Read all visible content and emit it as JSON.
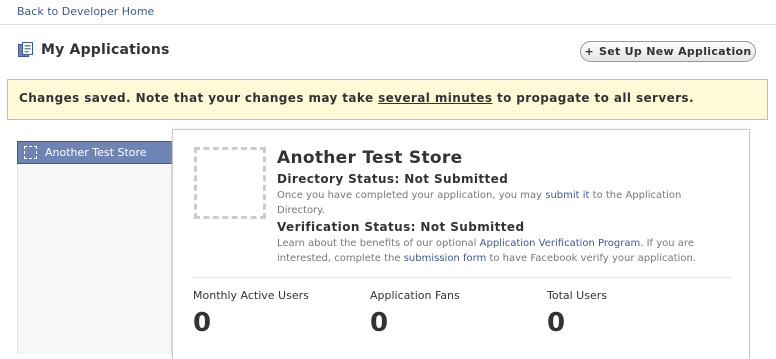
{
  "nav": {
    "back_link": "Back to Developer Home"
  },
  "header": {
    "title": "My Applications",
    "new_app_button": "Set Up New Application",
    "new_app_plus": "+"
  },
  "notice": {
    "before": "Changes saved. Note that your changes may take ",
    "link": "several minutes",
    "after": " to propagate to all servers."
  },
  "sidebar": {
    "items": [
      {
        "label": "Another Test Store"
      }
    ]
  },
  "app": {
    "name": "Another Test Store",
    "directory": {
      "title": "Directory Status: Not Submitted",
      "desc_before": "Once you have completed your application, you may ",
      "desc_link": "submit it",
      "desc_after": " to the Application Directory."
    },
    "verification": {
      "title": "Verification Status: Not Submitted",
      "desc_before": "Learn about the benefits of our optional ",
      "desc_link1": "Application Verification Program",
      "desc_mid": ". If you are interested, complete the ",
      "desc_link2": "submission form",
      "desc_after": " to have Facebook verify your application."
    },
    "stats": [
      {
        "label": "Monthly Active Users",
        "value": "0"
      },
      {
        "label": "Application Fans",
        "value": "0"
      },
      {
        "label": "Total Users",
        "value": "0"
      }
    ]
  },
  "colors": {
    "link": "#3b5998",
    "notice_bg": "#fff9d7",
    "notice_border": "#e2c822",
    "selected_bg": "#6d84b4"
  }
}
